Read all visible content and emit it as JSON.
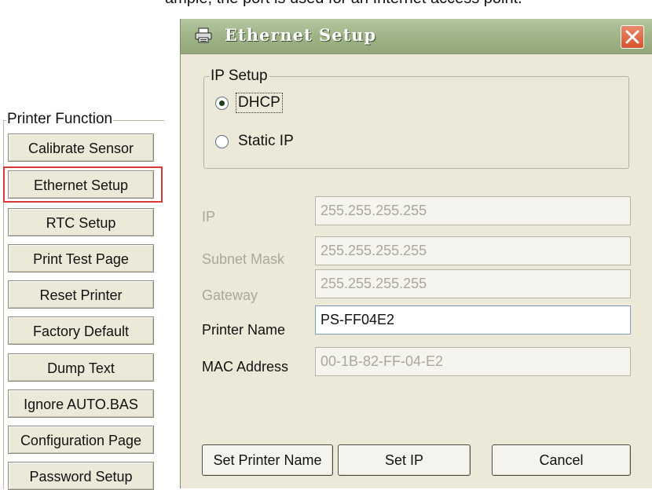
{
  "header_fragment": "ample, the port is used for an Internet access point.",
  "printer_function": {
    "legend": "Printer Function",
    "buttons": [
      {
        "label": "Calibrate Sensor"
      },
      {
        "label": "Ethernet Setup",
        "highlighted": true
      },
      {
        "label": "RTC Setup"
      },
      {
        "label": "Print Test Page"
      },
      {
        "label": "Reset Printer"
      },
      {
        "label": "Factory Default"
      },
      {
        "label": "Dump Text"
      },
      {
        "label": "Ignore AUTO.BAS"
      },
      {
        "label": "Configuration Page"
      },
      {
        "label": "Password Setup"
      }
    ],
    "highlight_color": "#d83a3a"
  },
  "dialog": {
    "title": "Ethernet Setup",
    "title_icon": "printer-icon",
    "close_icon": "close-icon",
    "ip_setup": {
      "legend": "IP Setup",
      "options": [
        {
          "label": "DHCP",
          "checked": true
        },
        {
          "label": "Static IP",
          "checked": false
        }
      ]
    },
    "fields": {
      "ip": {
        "label": "IP",
        "value": "255.255.255.255",
        "enabled": false
      },
      "subnet_mask": {
        "label": "Subnet Mask",
        "value": "255.255.255.255",
        "enabled": false
      },
      "gateway": {
        "label": "Gateway",
        "value": "255.255.255.255",
        "enabled": false
      },
      "printer_name": {
        "label": "Printer Name",
        "value": "PS-FF04E2",
        "enabled": true
      },
      "mac_address": {
        "label": "MAC Address",
        "value": "00-1B-82-FF-04-E2",
        "enabled": false
      }
    },
    "buttons": {
      "set_printer_name": "Set Printer Name",
      "set_ip": "Set IP",
      "cancel": "Cancel"
    }
  },
  "colors": {
    "titlebar": "#9db285",
    "dialog_bg": "#ece9d8",
    "close_button": "#d9522e",
    "disabled_text": "#aca899"
  }
}
